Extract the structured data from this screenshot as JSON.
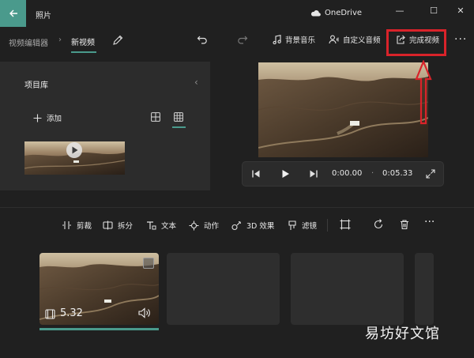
{
  "titlebar": {
    "app_title": "照片",
    "onedrive_label": "OneDrive",
    "minimize": "—",
    "maximize": "☐",
    "close": "✕"
  },
  "toolbar": {
    "breadcrumb_parent": "视频编辑器",
    "breadcrumb_sep": "›",
    "project_title": "新视频",
    "background_music": "背景音乐",
    "custom_audio": "自定义音频",
    "finish_video": "完成视频",
    "more": "···"
  },
  "library": {
    "title": "项目库",
    "add_label": "添加",
    "collapse": "‹"
  },
  "player": {
    "current_time": "0:00.00",
    "separator": "·",
    "total_time": "0:05.33"
  },
  "storyboard": {
    "tools": [
      {
        "label": "剪裁"
      },
      {
        "label": "拆分"
      },
      {
        "label": "文本"
      },
      {
        "label": "动作"
      },
      {
        "label": "3D 效果"
      },
      {
        "label": "滤镜"
      }
    ],
    "more": "···",
    "clip_duration": "5.32"
  },
  "watermark": "易坊好文馆",
  "colors": {
    "accent": "#4a9a8c",
    "annotation_red": "#d9232a",
    "background": "#202020",
    "panel": "#2c2c2c"
  }
}
